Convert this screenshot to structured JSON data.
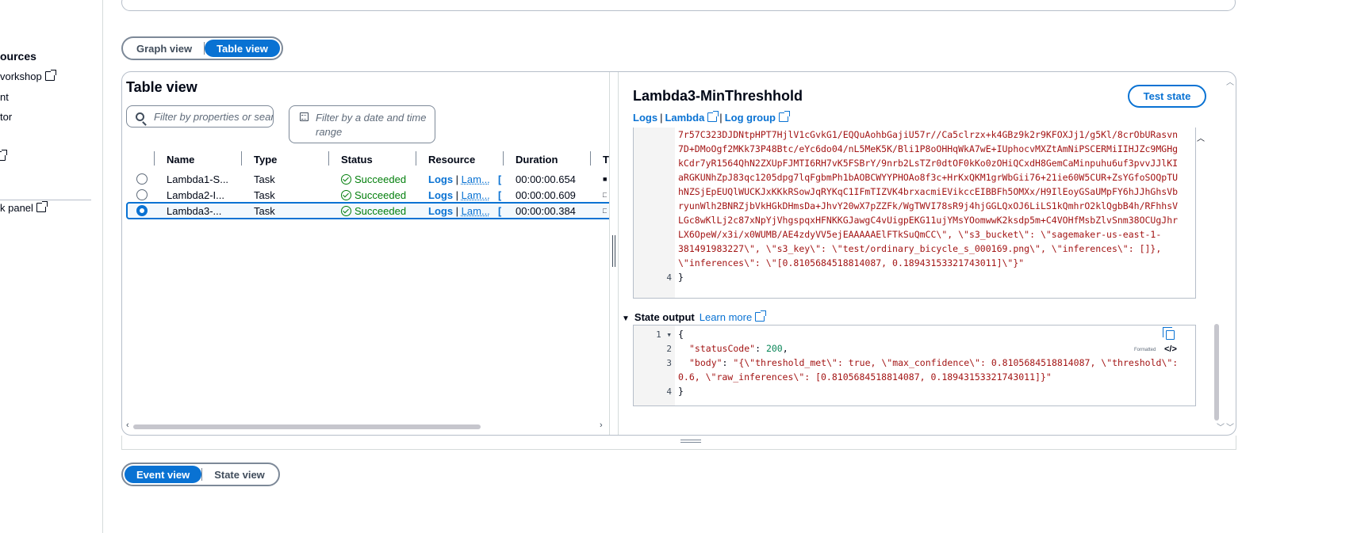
{
  "sidebar": {
    "items": [
      {
        "label": "ources",
        "bold": true,
        "ext": false
      },
      {
        "label": "vorkshop",
        "bold": false,
        "ext": true
      },
      {
        "label": "nt",
        "bold": false,
        "ext": false
      },
      {
        "label": "tor",
        "bold": false,
        "ext": false
      },
      {
        "label": "",
        "bold": false,
        "ext": true
      },
      {
        "label": "k panel",
        "bold": false,
        "ext": true
      }
    ]
  },
  "view_toggle_top": {
    "graph": "Graph view",
    "table": "Table view",
    "active": "table"
  },
  "view_toggle_bottom": {
    "event": "Event view",
    "state": "State view",
    "active": "event"
  },
  "table_view": {
    "title": "Table view",
    "filter_props_placeholder": "Filter by properties or search",
    "filter_date_placeholder": "Filter by a date and time range",
    "columns": [
      "Name",
      "Type",
      "Status",
      "Resource",
      "Duration",
      "T"
    ],
    "rows": [
      {
        "name": "Lambda1-S...",
        "type": "Task",
        "status": "Succeeded",
        "logs": "Logs",
        "lam": "Lam...",
        "duration": "00:00:00.654",
        "selected": false
      },
      {
        "name": "Lambda2-I...",
        "type": "Task",
        "status": "Succeeded",
        "logs": "Logs",
        "lam": "Lam...",
        "duration": "00:00:00.609",
        "selected": false
      },
      {
        "name": "Lambda3-...",
        "type": "Task",
        "status": "Succeeded",
        "logs": "Logs",
        "lam": "Lam...",
        "duration": "00:00:00.384",
        "selected": true
      }
    ]
  },
  "detail": {
    "title": "Lambda3-MinThreshhold",
    "test_state": "Test state",
    "link_logs": "Logs",
    "link_lambda": "Lambda",
    "link_log_group": "Log group",
    "input_lines": [
      "7r57C323DJDNtpHPT7HjlV1cGvkG1/EQQuAohbGajiU57r//Ca5clrzx+k4GBz9k2r9KFOXJj1/g5Kl/8crObURasvn",
      "7D+DMoOgf2MKk73P48Btc/eYc6do04/nL5MeK5K/Bli1P8oOHHqWkA7wE+IUphocvMXZtAmNiPSCERMiIIHJZc9MGHg",
      "kCdr7yR1564QhN2ZXUpFJMTI6RH7vK5FSBrY/9nrb2LsTZr0dtOF0kKo0zOHiQCxdH8GemCaMinpuhu6uf3pvvJJlKI",
      "aRGKUNhZpJ83qc1205dpg7lqFgbmPh1bAOBCWYYPHOAo8f3c+HrKxQKM1grWbGii76+21ie60W5CUR+ZsYGfoSOQpTU",
      "hNZSjEpEUQlWUCKJxKKkRSowJqRYKqC1IFmTIZVK4brxacmiEVikccEIBBFh5OMXx/H9IlEoyGSaUMpFY6hJJhGhsVb",
      "ryunWlh2BNRZjbVkHGkDHmsDa+JhvY20wX7pZZFk/WgTWVI78sR9j4hjGGLQxOJ6LiLS1kQmhrO2klQgbB4h/RFhhsV",
      "LGc8wKlLj2c87xNpYjVhgspqxHFNKKGJawgC4vUigpEKG11ujYMsYOomwwK2ksdp5m+C4VOHfMsbZlvSnm38OCUgJhr",
      "LX6OpeW/x3i/x0WUMB/AE4zdyVV5ejEAAAAAElFTkSuQmCC\\\", \\\"s3_bucket\\\": \\\"sagemaker-us-east-1-",
      "381491983227\\\", \\\"s3_key\\\": \\\"test/ordinary_bicycle_s_000169.png\\\", \\\"inferences\\\": []},",
      "\\\"inferences\\\": \\\"[0.8105684518814087, 0.18943153321743011]\\\"}\""
    ],
    "input_last_ln": "4",
    "input_close": "}",
    "state_output": {
      "label": "State output",
      "learn_more": "Learn more",
      "formatted": "Formatted",
      "line_nums": [
        "1",
        "2",
        "3",
        "4"
      ],
      "open": "{",
      "status_key": "\"statusCode\"",
      "status_val": "200",
      "body_key": "\"body\"",
      "body_val_1": "\"{\\\"threshold_met\\\": true, \\\"max_confidence\\\": 0.8105684518814087, \\\"threshold\\\":",
      "body_val_2": "0.6, \\\"raw_inferences\\\": [0.8105684518814087, 0.18943153321743011]}\"",
      "close": "}"
    }
  }
}
